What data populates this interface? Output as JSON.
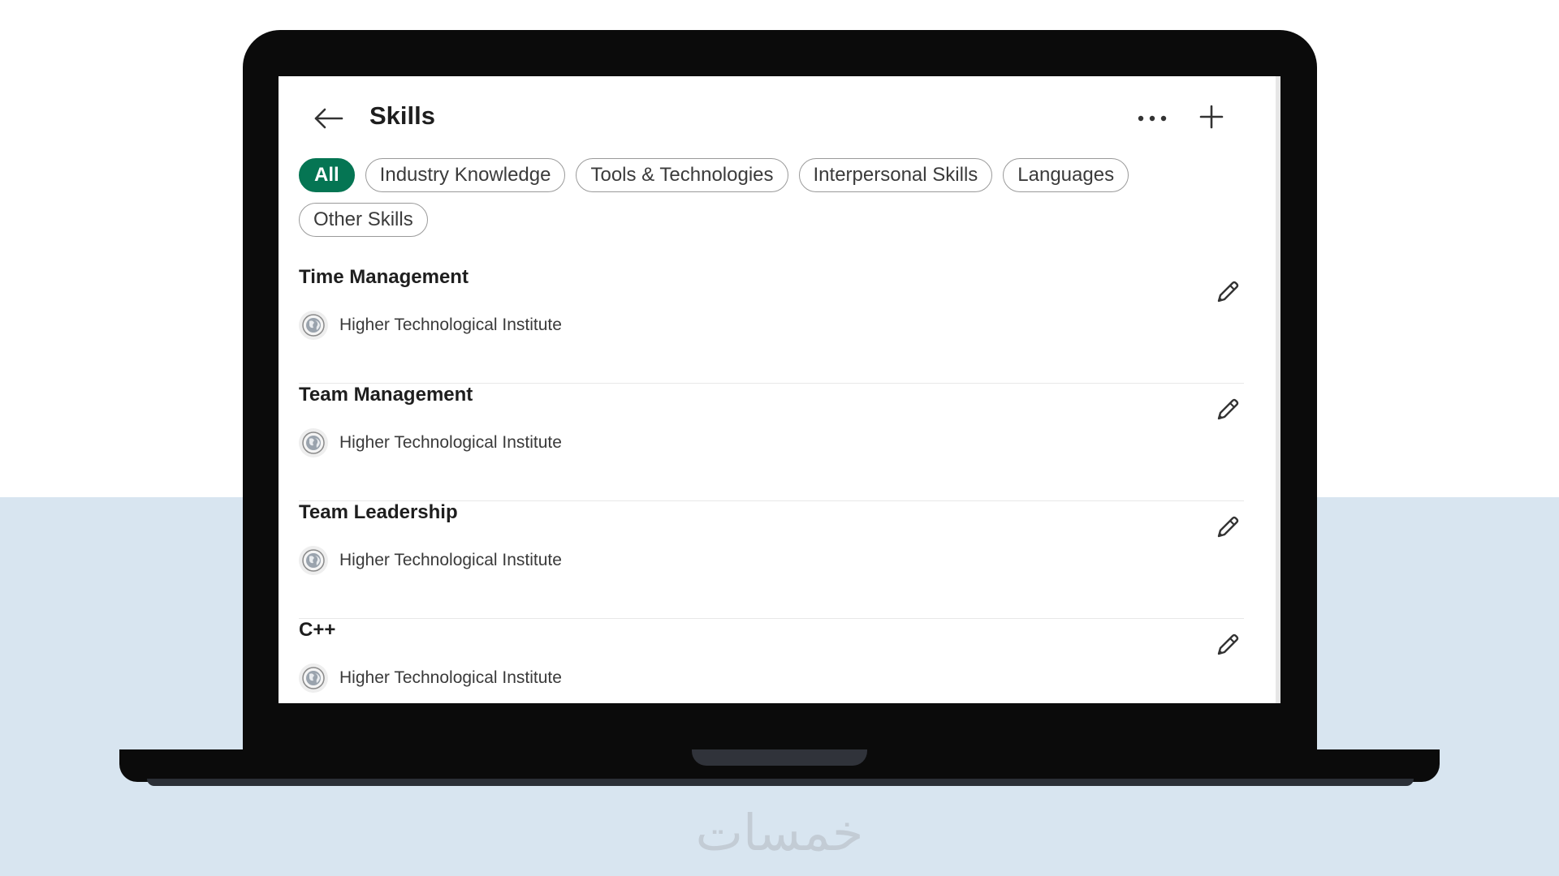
{
  "page": {
    "title": "Skills",
    "accent_color": "#057553",
    "backdrop_color": "#d8e5f0"
  },
  "header": {
    "back_icon": "arrow-left-icon",
    "more_icon": "more-horizontal-icon",
    "add_icon": "plus-icon"
  },
  "filters": {
    "selected": "All",
    "pills": [
      {
        "label": "All"
      },
      {
        "label": "Industry Knowledge"
      },
      {
        "label": "Tools & Technologies"
      },
      {
        "label": "Interpersonal Skills"
      },
      {
        "label": "Languages"
      },
      {
        "label": "Other Skills"
      }
    ]
  },
  "skills": [
    {
      "name": "Time Management",
      "source": "Higher Technological Institute",
      "edit_icon": "pencil-icon"
    },
    {
      "name": "Team Management",
      "source": "Higher Technological Institute",
      "edit_icon": "pencil-icon"
    },
    {
      "name": "Team Leadership",
      "source": "Higher Technological Institute",
      "edit_icon": "pencil-icon"
    },
    {
      "name": "C++",
      "source": "Higher Technological Institute",
      "edit_icon": "pencil-icon"
    }
  ],
  "watermark": {
    "text": "خمسات"
  }
}
